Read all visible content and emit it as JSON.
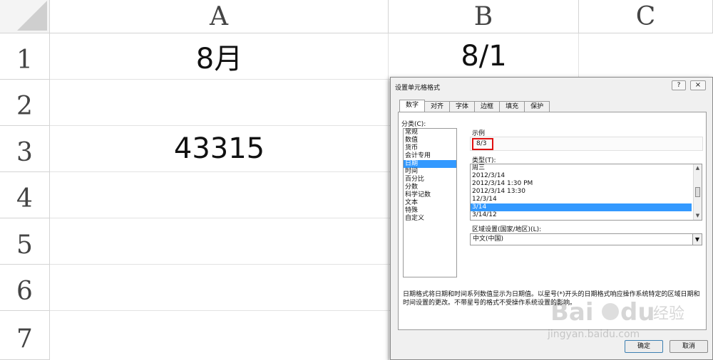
{
  "sheet": {
    "columns": [
      "A",
      "B",
      "C"
    ],
    "rows": [
      "1",
      "2",
      "3",
      "4",
      "5",
      "6",
      "7"
    ],
    "cells": {
      "A1": "8月",
      "B1": "8/1",
      "A3": "43315"
    }
  },
  "dialog": {
    "title": "设置单元格格式",
    "help": "?",
    "close": "×",
    "tabs": [
      "数字",
      "对齐",
      "字体",
      "边框",
      "填充",
      "保护"
    ],
    "category_label": "分类(C):",
    "categories": [
      "常规",
      "数值",
      "货币",
      "会计专用",
      "日期",
      "时间",
      "百分比",
      "分数",
      "科学记数",
      "文本",
      "特殊",
      "自定义"
    ],
    "selected_category": "日期",
    "sample_label": "示例",
    "sample_value": "8/3",
    "type_label": "类型(T):",
    "types": [
      "周三",
      "2012/3/14",
      "2012/3/14 1:30 PM",
      "2012/3/14 13:30",
      "12/3/14",
      "3/14",
      "3/14/12"
    ],
    "selected_type": "3/14",
    "locale_label": "区域设置(国家/地区)(L):",
    "locale_value": "中文(中国)",
    "description": "日期格式将日期和时间系列数值显示为日期值。以星号(*)开头的日期格式响应操作系统特定的区域日期和时间设置的更改。不带星号的格式不受操作系统设置的影响。",
    "ok_label": "确定",
    "cancel_label": "取消"
  },
  "watermark": {
    "text": "jingyan.baidu.com",
    "logo": "Bai du 经验"
  }
}
